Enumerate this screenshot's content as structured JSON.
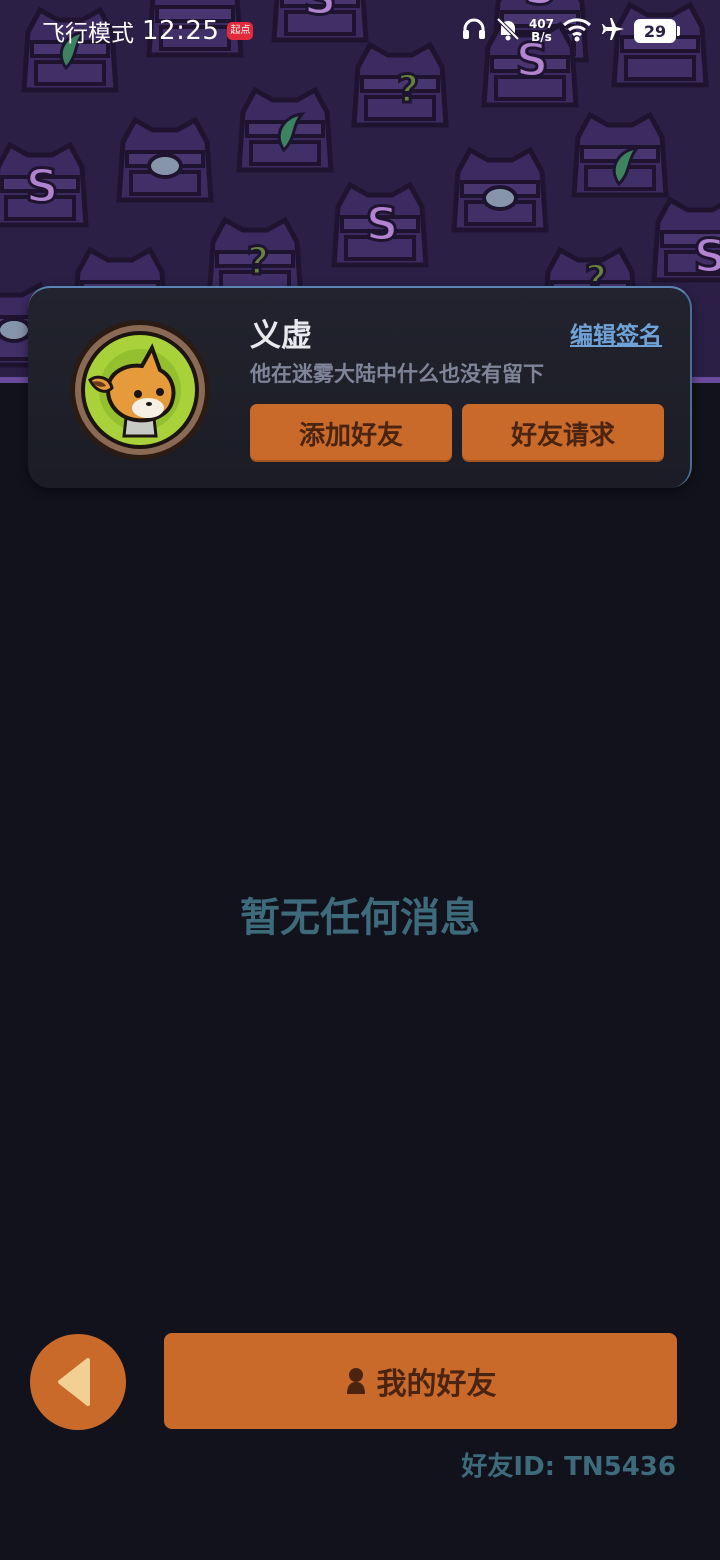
{
  "status_bar": {
    "mode": "飞行模式",
    "time": "12:25",
    "app_badge": "起点",
    "net_speed_value": "407",
    "net_speed_unit": "B/s",
    "battery": "29",
    "icons": [
      "headphones-icon",
      "bell-muted-icon",
      "wifi-icon",
      "airplane-icon",
      "battery-icon"
    ]
  },
  "profile": {
    "name": "义虚",
    "edit_signature": "编辑签名",
    "signature": "他在迷雾大陆中什么也没有留下",
    "add_friend": "添加好友",
    "friend_requests": "好友请求"
  },
  "main": {
    "empty_message": "暂无任何消息"
  },
  "bottom": {
    "my_friends": "我的好友",
    "friend_id": "好友ID: TN5436"
  },
  "colors": {
    "accent": "#c96a2a",
    "background": "#12121c",
    "pattern": "#2b1f46",
    "muted_teal": "#3d6b7c",
    "link": "#6fa3d8"
  }
}
